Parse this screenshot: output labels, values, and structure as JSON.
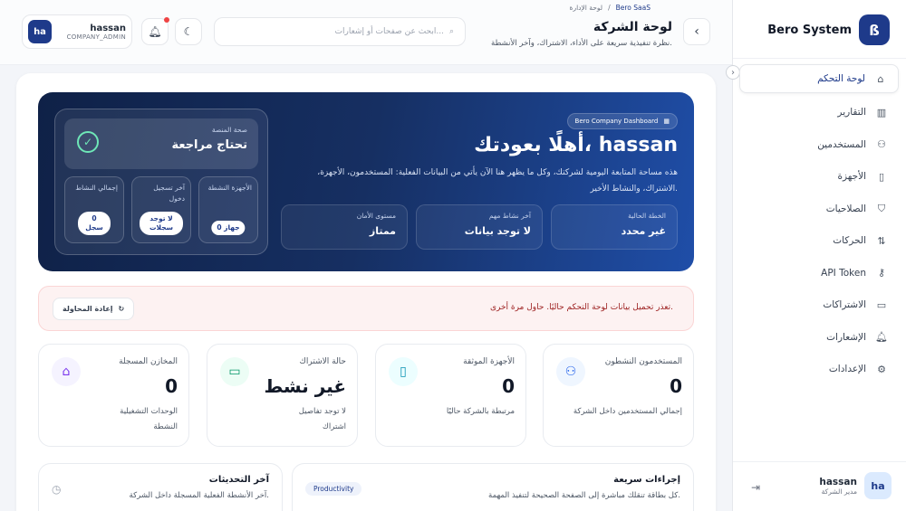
{
  "sidebar": {
    "brand": "Bero System",
    "brand_icon": "bero-logo-icon",
    "items": [
      {
        "label": "لوحة التحكم",
        "icon": "home-icon"
      },
      {
        "label": "التقارير",
        "icon": "bar-chart-icon"
      },
      {
        "label": "المستخدمين",
        "icon": "users-icon"
      },
      {
        "label": "الأجهزة",
        "icon": "tablet-icon"
      },
      {
        "label": "الصلاحيات",
        "icon": "shield-icon"
      },
      {
        "label": "الحركات",
        "icon": "arrows-icon"
      },
      {
        "label": "API Token",
        "icon": "key-icon"
      },
      {
        "label": "الاشتراكات",
        "icon": "credit-card-icon"
      },
      {
        "label": "الإشعارات",
        "icon": "bell-icon"
      },
      {
        "label": "الإعدادات",
        "icon": "gear-icon"
      }
    ],
    "user": {
      "avatar": "ha",
      "name": "hassan",
      "role": "مدير الشركة"
    }
  },
  "header": {
    "breadcrumb": [
      "Bero SaaS",
      "/",
      "لوحة الإدارة"
    ],
    "title": "لوحة الشركة",
    "subtitle": "نظرة تنفيذية سريعة على الأداء، الاشتراك، وآخر الأنشطة.",
    "search_placeholder": "ابحث عن صفحات أو إشعارات...",
    "user": {
      "avatar": "ha",
      "name": "hassan",
      "role": "COMPANY_ADMIN"
    }
  },
  "hero": {
    "badge": "Bero Company Dashboard",
    "title": "أهلًا بعودتك، hassan",
    "description": "هذه مساحة المتابعة اليومية لشركتك، وكل ما يظهر هنا الآن يأتي من البيانات الفعلية: المستخدمون، الأجهزة، الاشتراك، والنشاط الأخير.",
    "mini": [
      {
        "label": "الخطة الحالية",
        "value": "غير محدد"
      },
      {
        "label": "آخر نشاط مهم",
        "value": "لا توجد بيانات"
      },
      {
        "label": "مستوى الأمان",
        "value": "ممتاز"
      }
    ],
    "health": {
      "label": "صحة المنصة",
      "value": "تحتاج مراجعة"
    },
    "stats": [
      {
        "label": "الأجهزة النشطة",
        "value": "0 جهاز"
      },
      {
        "label": "آخر تسجيل دخول",
        "value": "لا توجد سجلات"
      },
      {
        "label": "إجمالي النشاط",
        "value": "0 سجل"
      }
    ]
  },
  "alert": {
    "text": "تعذر تحميل بيانات لوحة التحكم حاليًا. حاول مرة أخرى.",
    "retry": "إعادة المحاولة"
  },
  "kpis": [
    {
      "label": "المستخدمون النشطون",
      "value": "0",
      "sub": "إجمالي المستخدمين داخل الشركة",
      "icon": "users-icon",
      "color": "#eff6ff",
      "fg": "#2563eb"
    },
    {
      "label": "الأجهزة الموثقة",
      "value": "0",
      "sub": "مرتبطة بالشركة حاليًا",
      "icon": "tablet-icon",
      "color": "#ecfeff",
      "fg": "#0891b2"
    },
    {
      "label": "حالة الاشتراك",
      "value": "غير نشط",
      "sub": "لا توجد تفاصيل اشتراك",
      "icon": "credit-card-icon",
      "color": "#ecfdf5",
      "fg": "#059669"
    },
    {
      "label": "المخازن المسجلة",
      "value": "0",
      "sub": "الوحدات التشغيلية النشطة",
      "icon": "store-icon",
      "color": "#f5f3ff",
      "fg": "#7c3aed"
    }
  ],
  "panels": {
    "quick": {
      "title": "إجراءات سريعة",
      "sub": "كل بطاقة تنقلك مباشرة إلى الصفحة الصحيحة لتنفيذ المهمة.",
      "tag": "Productivity"
    },
    "updates": {
      "title": "آخر التحديثات",
      "sub": "آخر الأنشطة الفعلية المسجلة داخل الشركة."
    }
  }
}
